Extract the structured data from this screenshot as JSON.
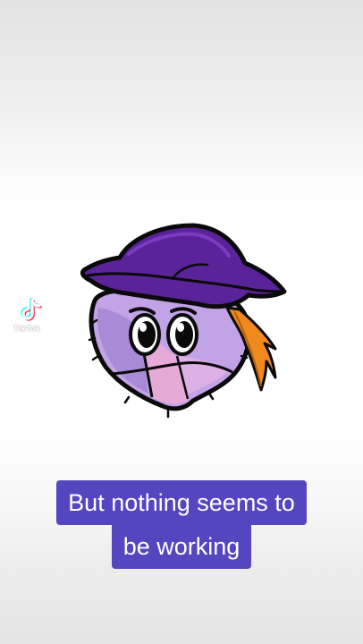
{
  "watermark": {
    "icon": "tiktok-logo-icon",
    "label": "TikTok"
  },
  "illustration": {
    "subject": "purple-hat-character"
  },
  "caption": {
    "lines": [
      "But nothing seems to",
      "be working"
    ],
    "background_color": "#5346bf",
    "text_color": "#ffffff"
  }
}
